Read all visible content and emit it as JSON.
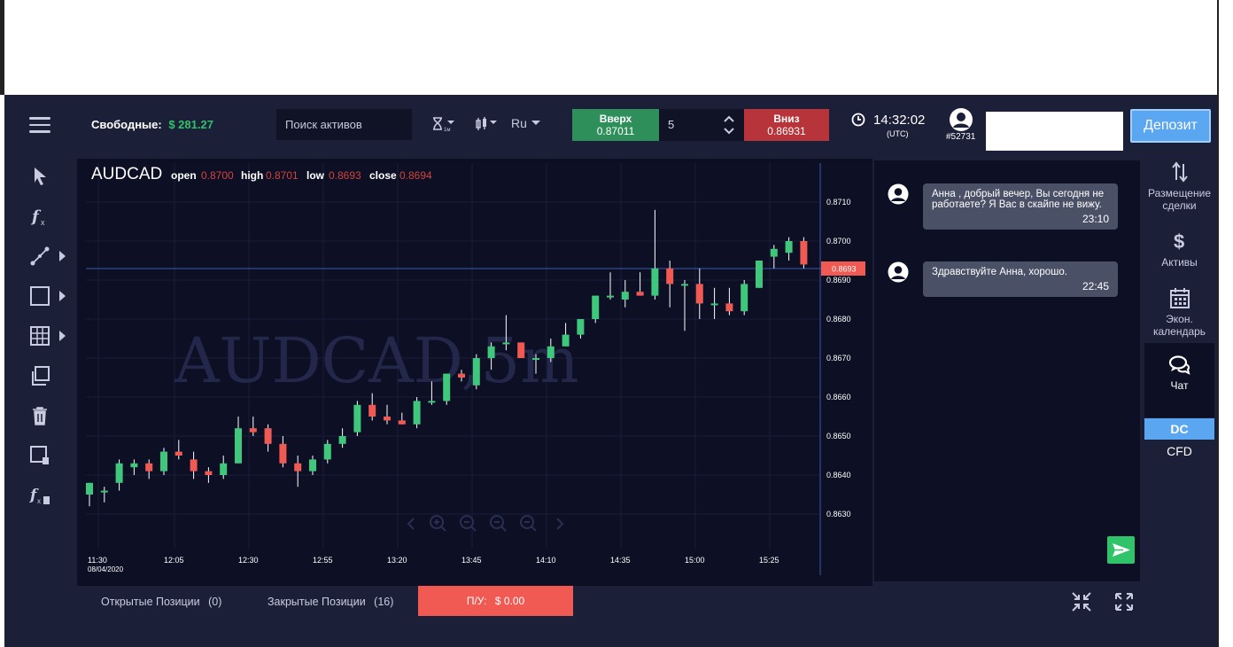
{
  "header": {
    "free_label": "Свободные:",
    "free_amount": "$ 281.27",
    "search_placeholder": "Поиск активов",
    "language": "Ru",
    "up_label": "Вверх",
    "up_price": "0.87011",
    "amount": "5",
    "down_label": "Вниз",
    "down_price": "0.86931",
    "time": "14:32:02",
    "utc": "(UTC)",
    "user_id": "#52731",
    "deposit_label": "Депозит"
  },
  "toolbar": {
    "icons": [
      "cursor-icon",
      "indicator-icon",
      "line-tool-icon",
      "rectangle-tool-icon",
      "grid-layout-icon",
      "copy-icon",
      "trash-icon",
      "remove-drawing-icon",
      "remove-indicator-icon"
    ]
  },
  "chart": {
    "symbol": "AUDCAD",
    "open_label": "open",
    "open_value": "0.8700",
    "high_label": "high",
    "high_value": "0.8701",
    "low_label": "low",
    "low_value": "0.8693",
    "close_label": "close",
    "close_value": "0.8694",
    "watermark": "AUDCAD,5m",
    "current_price": "0.8693",
    "date": "08/04/2020",
    "y_ticks": [
      "0.8710",
      "0.8700",
      "0.8690",
      "0.8680",
      "0.8670",
      "0.8660",
      "0.8650",
      "0.8640",
      "0.8630"
    ],
    "x_ticks": [
      "11:30",
      "12:05",
      "12:30",
      "12:55",
      "13:20",
      "13:45",
      "14:10",
      "14:35",
      "15:00",
      "15:25"
    ]
  },
  "chart_data": {
    "type": "candlestick",
    "title": "AUDCAD",
    "y_range": [
      0.8625,
      0.872
    ],
    "current_price": 0.8693,
    "up_color": "#3fc77c",
    "down_color": "#f05a52",
    "candles": [
      {
        "o": 0.8635,
        "h": 0.8638,
        "l": 0.8632,
        "c": 0.8638
      },
      {
        "o": 0.8636,
        "h": 0.8637,
        "l": 0.8633,
        "c": 0.8636
      },
      {
        "o": 0.8638,
        "h": 0.8644,
        "l": 0.8636,
        "c": 0.8643
      },
      {
        "o": 0.8642,
        "h": 0.8644,
        "l": 0.864,
        "c": 0.8643
      },
      {
        "o": 0.8643,
        "h": 0.8644,
        "l": 0.8639,
        "c": 0.8641
      },
      {
        "o": 0.8641,
        "h": 0.8647,
        "l": 0.864,
        "c": 0.8646
      },
      {
        "o": 0.8646,
        "h": 0.8649,
        "l": 0.8644,
        "c": 0.8645
      },
      {
        "o": 0.8644,
        "h": 0.8646,
        "l": 0.8639,
        "c": 0.8641
      },
      {
        "o": 0.8641,
        "h": 0.8642,
        "l": 0.8638,
        "c": 0.864
      },
      {
        "o": 0.864,
        "h": 0.8645,
        "l": 0.8639,
        "c": 0.8643
      },
      {
        "o": 0.8643,
        "h": 0.8655,
        "l": 0.8643,
        "c": 0.8652
      },
      {
        "o": 0.8652,
        "h": 0.8655,
        "l": 0.865,
        "c": 0.8651
      },
      {
        "o": 0.8652,
        "h": 0.8653,
        "l": 0.8646,
        "c": 0.8648
      },
      {
        "o": 0.8648,
        "h": 0.865,
        "l": 0.8642,
        "c": 0.8643
      },
      {
        "o": 0.8643,
        "h": 0.8645,
        "l": 0.8637,
        "c": 0.8641
      },
      {
        "o": 0.8641,
        "h": 0.8645,
        "l": 0.864,
        "c": 0.8644
      },
      {
        "o": 0.8644,
        "h": 0.8649,
        "l": 0.8643,
        "c": 0.8648
      },
      {
        "o": 0.8648,
        "h": 0.8652,
        "l": 0.8647,
        "c": 0.865
      },
      {
        "o": 0.8651,
        "h": 0.8659,
        "l": 0.865,
        "c": 0.8658
      },
      {
        "o": 0.8658,
        "h": 0.8661,
        "l": 0.8654,
        "c": 0.8655
      },
      {
        "o": 0.8655,
        "h": 0.8658,
        "l": 0.8653,
        "c": 0.8654
      },
      {
        "o": 0.8654,
        "h": 0.8656,
        "l": 0.8653,
        "c": 0.8653
      },
      {
        "o": 0.8653,
        "h": 0.866,
        "l": 0.8652,
        "c": 0.8659
      },
      {
        "o": 0.8659,
        "h": 0.8664,
        "l": 0.8658,
        "c": 0.8659
      },
      {
        "o": 0.8659,
        "h": 0.8666,
        "l": 0.8658,
        "c": 0.8666
      },
      {
        "o": 0.8666,
        "h": 0.8667,
        "l": 0.8664,
        "c": 0.8665
      },
      {
        "o": 0.8663,
        "h": 0.8671,
        "l": 0.8662,
        "c": 0.867
      },
      {
        "o": 0.867,
        "h": 0.8674,
        "l": 0.8667,
        "c": 0.8673
      },
      {
        "o": 0.8674,
        "h": 0.8681,
        "l": 0.8672,
        "c": 0.8674
      },
      {
        "o": 0.8674,
        "h": 0.8674,
        "l": 0.8671,
        "c": 0.867
      },
      {
        "o": 0.867,
        "h": 0.8671,
        "l": 0.8666,
        "c": 0.867
      },
      {
        "o": 0.867,
        "h": 0.8675,
        "l": 0.8669,
        "c": 0.8673
      },
      {
        "o": 0.8673,
        "h": 0.8679,
        "l": 0.8673,
        "c": 0.8676
      },
      {
        "o": 0.8676,
        "h": 0.8679,
        "l": 0.8675,
        "c": 0.868
      },
      {
        "o": 0.868,
        "h": 0.8686,
        "l": 0.8679,
        "c": 0.8686
      },
      {
        "o": 0.8686,
        "h": 0.8692,
        "l": 0.8685,
        "c": 0.8686
      },
      {
        "o": 0.8685,
        "h": 0.869,
        "l": 0.8683,
        "c": 0.8687
      },
      {
        "o": 0.8687,
        "h": 0.8692,
        "l": 0.8687,
        "c": 0.8686
      },
      {
        "o": 0.8686,
        "h": 0.8708,
        "l": 0.8685,
        "c": 0.8693
      },
      {
        "o": 0.8693,
        "h": 0.8695,
        "l": 0.8683,
        "c": 0.8689
      },
      {
        "o": 0.8689,
        "h": 0.869,
        "l": 0.8677,
        "c": 0.8689
      },
      {
        "o": 0.8689,
        "h": 0.8693,
        "l": 0.868,
        "c": 0.8684
      },
      {
        "o": 0.8684,
        "h": 0.8688,
        "l": 0.868,
        "c": 0.8684
      },
      {
        "o": 0.8684,
        "h": 0.8688,
        "l": 0.8681,
        "c": 0.8682
      },
      {
        "o": 0.8682,
        "h": 0.869,
        "l": 0.8681,
        "c": 0.8689
      },
      {
        "o": 0.8688,
        "h": 0.8695,
        "l": 0.8688,
        "c": 0.8695
      },
      {
        "o": 0.8696,
        "h": 0.8699,
        "l": 0.8693,
        "c": 0.8698
      },
      {
        "o": 0.8697,
        "h": 0.8701,
        "l": 0.8695,
        "c": 0.87
      },
      {
        "o": 0.87,
        "h": 0.8701,
        "l": 0.8693,
        "c": 0.8694
      }
    ]
  },
  "chat": {
    "messages": [
      {
        "text": "Анна , добрый вечер, Вы сегодня не работаете? Я Вас в скайпе не вижу.",
        "time": "23:10"
      },
      {
        "text": "Здравствуйте Анна, хорошо.",
        "time": "22:45"
      }
    ]
  },
  "right_panel": {
    "place_trade": "Размещение сделки",
    "assets": "Активы",
    "econ_calendar": "Экон. календарь",
    "chat": "Чат",
    "dc": "DC",
    "cfd": "CFD"
  },
  "bottom": {
    "open_positions": "Открытые Позиции",
    "open_count": "(0)",
    "closed_positions": "Закрытые Позиции",
    "closed_count": "(16)",
    "pnl_label": "П/У:",
    "pnl_value": "$ 0.00"
  }
}
